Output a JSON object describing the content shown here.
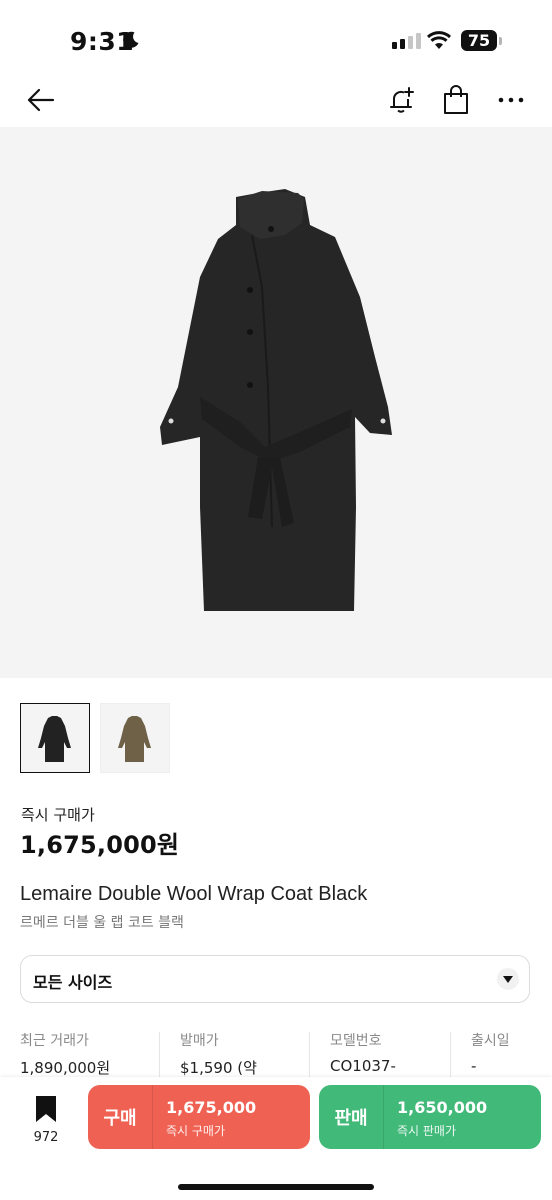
{
  "status_bar": {
    "time": "9:31",
    "battery": "75"
  },
  "product": {
    "price_label": "즉시 구매가",
    "price": "1,675,000원",
    "name_en": "Lemaire Double Wool Wrap Coat Black",
    "name_ko": "르메르 더블 울 랩 코트 블랙"
  },
  "size_selector": {
    "label": "모든 사이즈"
  },
  "info": [
    {
      "label": "최근 거래가",
      "value": "1,890,000원"
    },
    {
      "label": "발매가",
      "value": "$1,590 (약"
    },
    {
      "label": "모델번호",
      "value": "CO1037-"
    },
    {
      "label": "출시일",
      "value": "-"
    }
  ],
  "bottom_bar": {
    "wishlist_count": "972",
    "buy": {
      "kind": "구매",
      "amount": "1,675,000",
      "sub": "즉시 구매가"
    },
    "sell": {
      "kind": "판매",
      "amount": "1,650,000",
      "sub": "즉시 판매가"
    }
  },
  "colors": {
    "buy": "#ef6253",
    "sell": "#41b979",
    "image_bg": "#f4f4f4"
  }
}
